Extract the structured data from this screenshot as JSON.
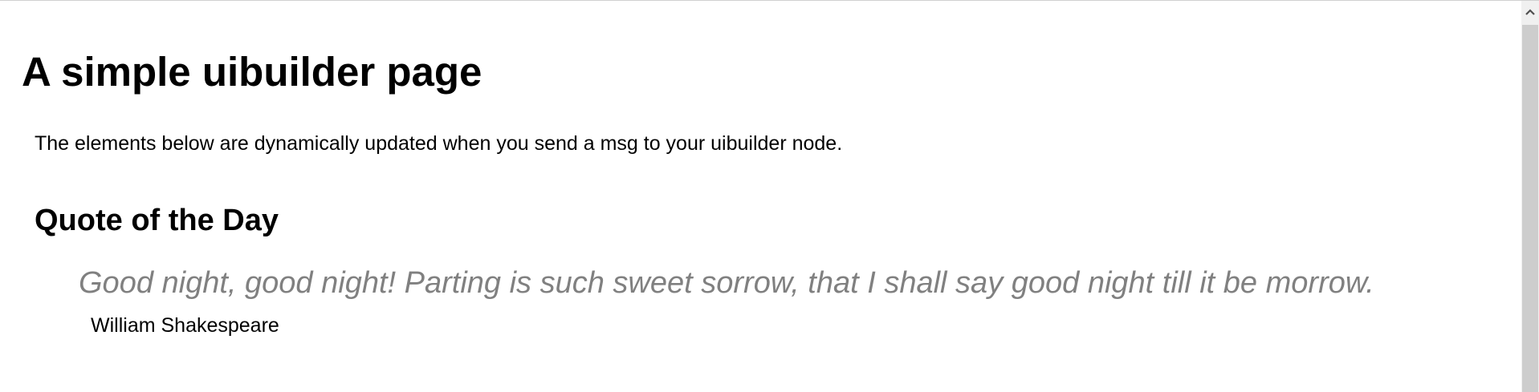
{
  "page": {
    "title": "A simple uibuilder page",
    "intro": "The elements below are dynamically updated when you send a msg to your uibuilder node."
  },
  "quote_section": {
    "heading": "Quote of the Day",
    "quote": "Good night, good night! Parting is such sweet sorrow, that I shall say good night till it be morrow.",
    "author": "William Shakespeare"
  },
  "scrollbar": {
    "up_icon": "chevron-up-icon"
  },
  "colors": {
    "quote_text": "#808080",
    "scrollbar_track": "#f0f0f0",
    "scrollbar_thumb": "#cdcdcd"
  }
}
